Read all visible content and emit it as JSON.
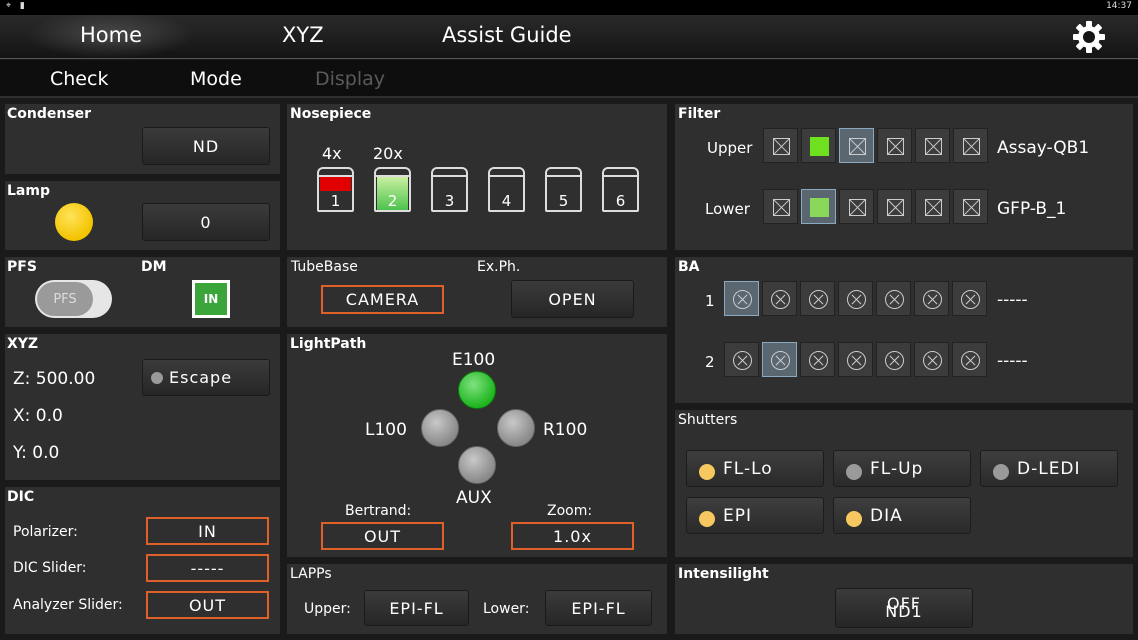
{
  "colors": {
    "accent_orange": "#e0602a",
    "green_on": "#1fb51f",
    "lamp_yellow": "#f3c300",
    "red": "#e00000"
  },
  "statusbar": {
    "time": "14:37"
  },
  "nav": {
    "tabs": [
      "Home",
      "XYZ",
      "Assist Guide"
    ],
    "settings_icon": "gear-icon"
  },
  "subnav": {
    "tabs": [
      "Check",
      "Mode",
      "Display"
    ]
  },
  "condenser": {
    "title": "Condenser",
    "button": "ND"
  },
  "lamp": {
    "title": "Lamp",
    "value": "0"
  },
  "pfs": {
    "title": "PFS",
    "toggle_label": "PFS"
  },
  "dm": {
    "title": "DM",
    "button": "IN"
  },
  "xyz": {
    "title": "XYZ",
    "z": "Z: 500.00",
    "x": "X: 0.0",
    "y": "Y: 0.0",
    "escape": "Escape"
  },
  "dic": {
    "title": "DIC",
    "polarizer_label": "Polarizer:",
    "polarizer": "IN",
    "slider_label": "DIC Slider:",
    "slider": "-----",
    "analyzer_label": "Analyzer Slider:",
    "analyzer": "OUT"
  },
  "nosepiece": {
    "title": "Nosepiece",
    "labels": [
      "4x",
      "20x"
    ],
    "slots": [
      "1",
      "2",
      "3",
      "4",
      "5",
      "6"
    ]
  },
  "tubebase": {
    "title": "TubeBase",
    "value": "CAMERA"
  },
  "exph": {
    "title": "Ex.Ph.",
    "value": "OPEN"
  },
  "lightpath": {
    "title": "LightPath",
    "top": "E100",
    "left": "L100",
    "right": "R100",
    "bottom": "AUX",
    "bertrand_label": "Bertrand:",
    "bertrand": "OUT",
    "zoom_label": "Zoom:",
    "zoom": "1.0x"
  },
  "lapps": {
    "title": "LAPPs",
    "upper_label": "Upper:",
    "upper": "EPI-FL",
    "lower_label": "Lower:",
    "lower": "EPI-FL"
  },
  "filter": {
    "title": "Filter",
    "upper_label": "Upper",
    "upper_name": "Assay-QB1",
    "lower_label": "Lower",
    "lower_name": "GFP-B_1"
  },
  "ba": {
    "title": "BA",
    "row1": "1",
    "row2": "2",
    "row1_name": "-----",
    "row2_name": "-----"
  },
  "shutters": {
    "title": "Shutters",
    "items": [
      "FL-Lo",
      "FL-Up",
      "D-LEDI",
      "EPI",
      "DIA"
    ]
  },
  "intensilight": {
    "title": "Intensilight",
    "button": "OFF",
    "button_sub": "ND1"
  }
}
